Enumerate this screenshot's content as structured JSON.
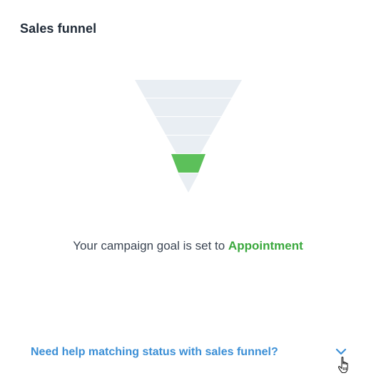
{
  "panel": {
    "title": "Sales funnel"
  },
  "funnel": {
    "stages": 6,
    "highlighted_stage_index": 4,
    "colors": {
      "stage": "#e9eef3",
      "highlight": "#5cc05a"
    }
  },
  "goal": {
    "prefix": "Your campaign goal is set to ",
    "value": "Appointment"
  },
  "help": {
    "label": "Need help matching status with sales funnel?",
    "expand_icon": "chevron-down-icon"
  },
  "colors": {
    "title": "#1f2a37",
    "body_text": "#3b4553",
    "accent_green": "#3aa83d",
    "link_blue": "#3b8fd6"
  }
}
